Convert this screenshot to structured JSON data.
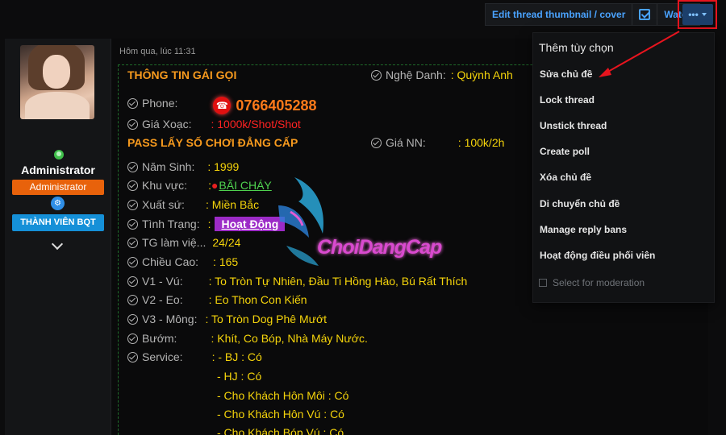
{
  "toolbar": {
    "edit_thumbnail": "Edit thread thumbnail / cover",
    "watch": "Watch",
    "more": "•••"
  },
  "user": {
    "name": "Administrator",
    "role": "Administrator",
    "group": "THÀNH VIÊN BQT"
  },
  "post": {
    "date": "Hôm qua, lúc 11:31",
    "title": "THÔNG TIN GÁI GỌI",
    "subtitle": "PASS LẤY SỐ CHƠI ĐẲNG CẤP",
    "nghe_danh_label": "Nghệ Danh:",
    "nghe_danh_value": ": Quỳnh Anh",
    "phone_label": "Phone:",
    "phone_value": "0766405288",
    "gia_xoac_label": "Giá Xoạc:",
    "gia_xoac_value": ": 1000k/Shot/Shot",
    "gia_nn_label": "Giá NN:",
    "gia_nn_value": ": 100k/2h",
    "nam_sinh_label": "Năm Sinh:",
    "nam_sinh_value": ": 1999",
    "khu_vuc_label": "Khu vực:",
    "khu_vuc_prefix": ":",
    "khu_vuc_value": "BÃI CHÁY",
    "xuat_su_label": "Xuất sứ:",
    "xuat_su_value": ": Miền Bắc",
    "tinh_trang_label": "Tình Trạng:",
    "tinh_trang_prefix": ":",
    "tinh_trang_value": "Hoạt Động",
    "tg_label": "TG làm việ...",
    "tg_value": "24/24",
    "chieu_cao_label": "Chiều Cao:",
    "chieu_cao_value": ": 165",
    "v1_label": "V1 - Vú:",
    "v1_value": ": To Tròn Tự Nhiên, Đầu Ti Hồng Hào, Bú Rất Thích",
    "v2_label": "V2 - Eo:",
    "v2_value": ": Eo Thon Con Kiến",
    "v3_label": "V3 - Mông:",
    "v3_value": ": To Tròn Dog Phê Mướt",
    "buom_label": "Bướm:",
    "buom_value": ": Khít, Co Bóp, Nhà Máy Nước.",
    "service_label": "Service:",
    "services": [
      ": - BJ : Có",
      "- HJ : Có",
      "- Cho Khách Hôn Môi : Có",
      "- Cho Khách Hôn Vú : Có",
      "- Cho Khách Bóp Vú : Có"
    ],
    "watermark": "ChoiDangCap"
  },
  "menu": {
    "title": "Thêm tùy chọn",
    "items": [
      "Sửa chủ đề",
      "Lock thread",
      "Unstick thread",
      "Create poll",
      "Xóa chủ đề",
      "Di chuyển chủ đề",
      "Manage reply bans",
      "Hoạt động điều phối viên"
    ],
    "select_moderation": "Select for moderation"
  },
  "colors": {
    "accent_blue": "#4aa3ff",
    "annotation_red": "#e8141e",
    "value_yellow": "#f5d40b",
    "role_orange": "#e8620b"
  }
}
